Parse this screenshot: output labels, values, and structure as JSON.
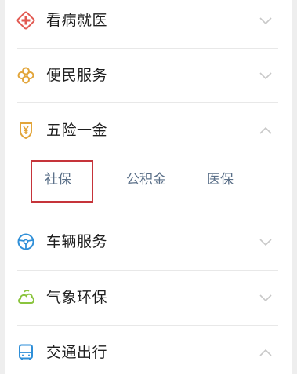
{
  "menu": {
    "items": [
      {
        "label": "看病就医",
        "icon": "medical-cross-icon",
        "expanded": false,
        "color": "#e25a52"
      },
      {
        "label": "便民服务",
        "icon": "clover-icon",
        "expanded": false,
        "color": "#e2a53a"
      },
      {
        "label": "五险一金",
        "icon": "shield-yen-icon",
        "expanded": true,
        "color": "#e2a53a"
      },
      {
        "label": "车辆服务",
        "icon": "steering-wheel-icon",
        "expanded": false,
        "color": "#2f8fd8"
      },
      {
        "label": "气象环保",
        "icon": "cloud-leaf-icon",
        "expanded": false,
        "color": "#8ac43d"
      },
      {
        "label": "交通出行",
        "icon": "bus-icon",
        "expanded": true,
        "color": "#2f8fd8"
      }
    ],
    "subitems": [
      {
        "label": "社保",
        "selected": true
      },
      {
        "label": "公积金",
        "selected": false
      },
      {
        "label": "医保",
        "selected": false
      }
    ]
  },
  "colors": {
    "subitem_text": "#5a6f88",
    "highlight_border": "#c6343a",
    "chevron": "#c8c8c8"
  }
}
